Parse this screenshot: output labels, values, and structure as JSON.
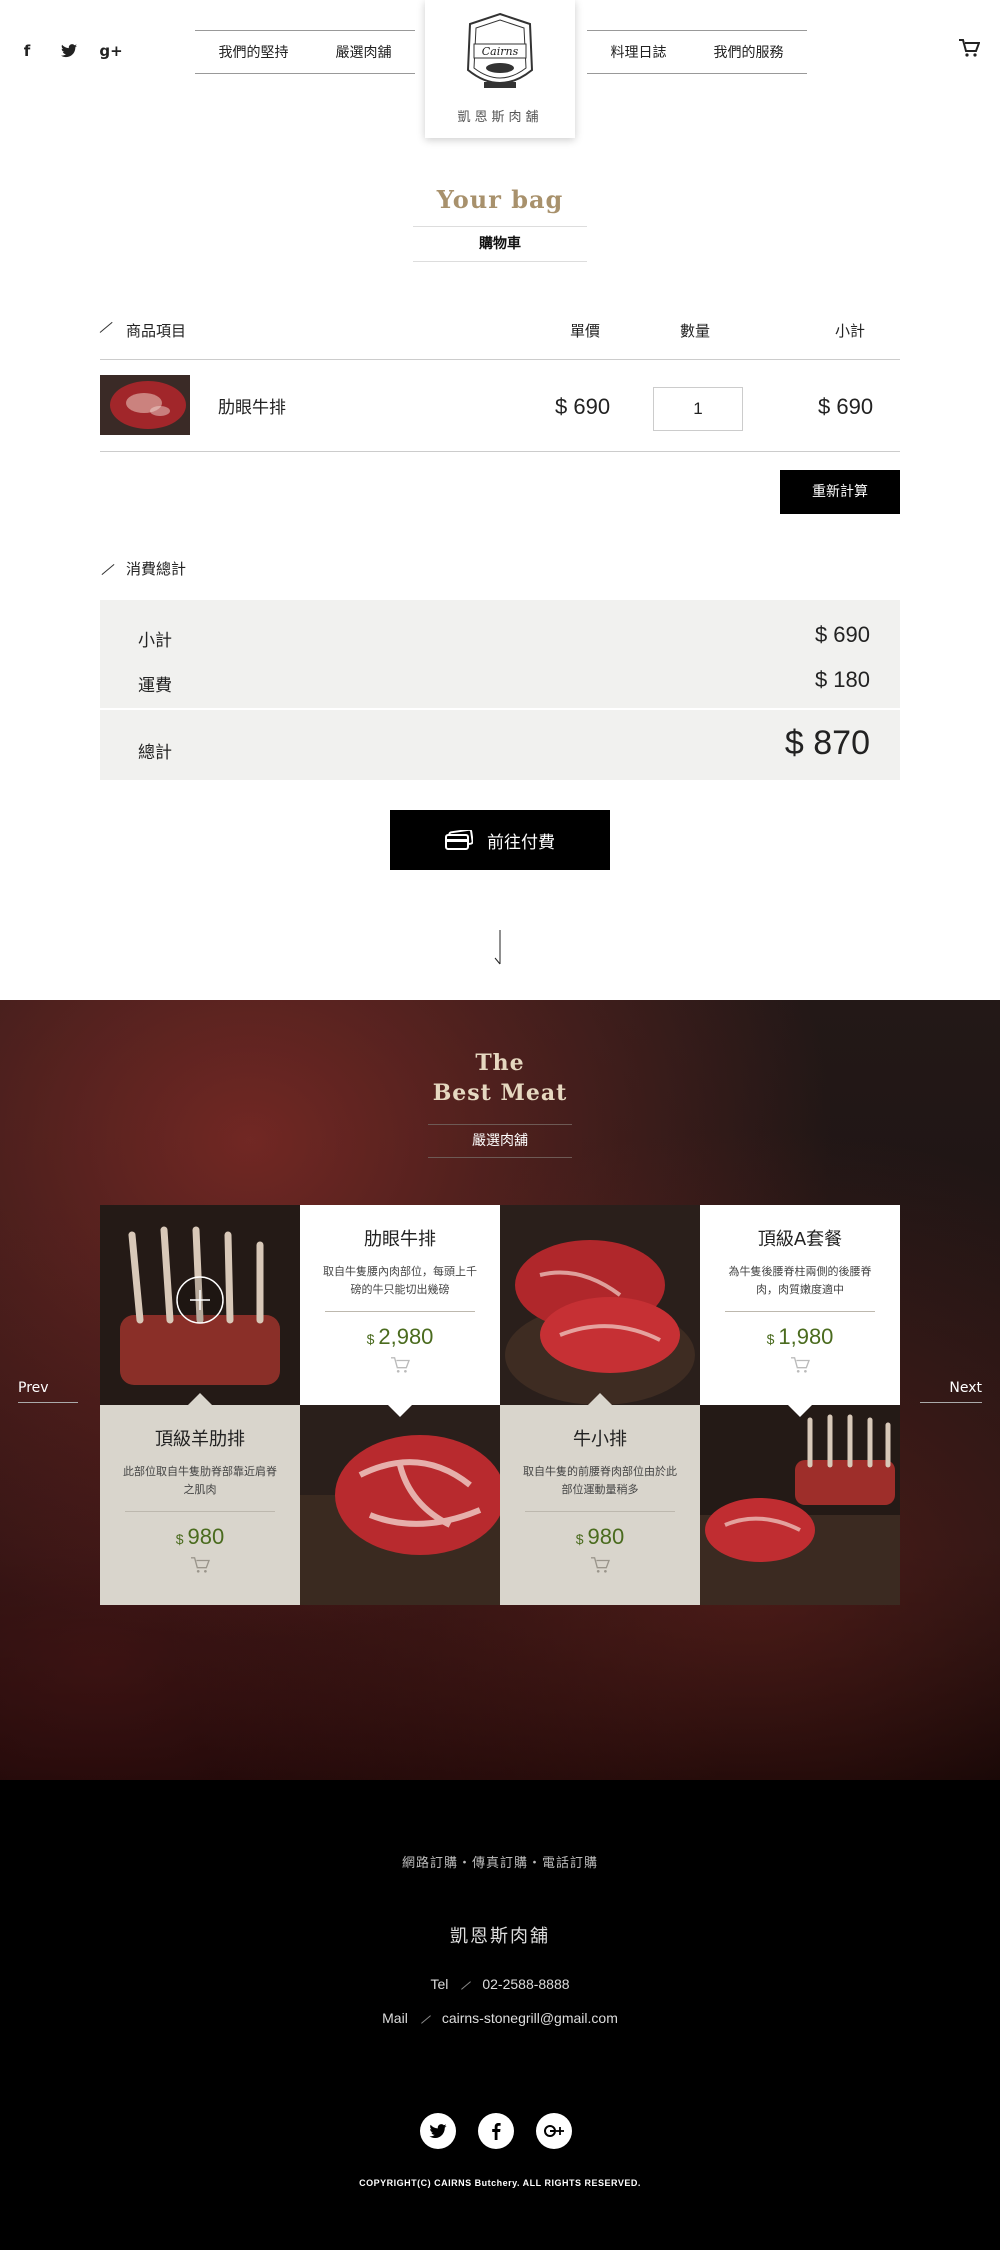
{
  "header": {
    "social": [
      "facebook-icon",
      "twitter-icon",
      "google-plus-icon"
    ],
    "social_glyphs": [
      "f",
      "t",
      "g+"
    ],
    "nav_left": [
      "我們的堅持",
      "嚴選肉舖"
    ],
    "nav_right": [
      "料理日誌",
      "我們的服務"
    ],
    "logo_text": "凱恩斯肉舖"
  },
  "cart": {
    "title_en": "Your bag",
    "title_zh": "購物車",
    "columns": {
      "item": "商品項目",
      "price": "單價",
      "qty": "數量",
      "subtotal": "小計"
    },
    "rows": [
      {
        "name": "肋眼牛排",
        "price": "$ 690",
        "qty": "1",
        "subtotal": "$ 690"
      }
    ],
    "recalc_label": "重新計算"
  },
  "totals": {
    "section_label": "消費總計",
    "subtotal_label": "小計",
    "subtotal_value": "$ 690",
    "shipping_label": "運費",
    "shipping_value": "$ 180",
    "total_label": "總計",
    "total_value": "$ 870"
  },
  "checkout_label": "前往付費",
  "meat": {
    "title_line1": "The",
    "title_line2": "Best Meat",
    "subtitle": "嚴選肉舖",
    "prev": "Prev",
    "next": "Next",
    "products": [
      {
        "name": "肋眼牛排",
        "desc": "取自牛隻腰內肉部位，每頭上千磅的牛只能切出幾磅",
        "currency": "$",
        "price": "2,980"
      },
      {
        "name": "頂級A套餐",
        "desc": "為牛隻後腰脊柱兩側的後腰脊肉，肉質嫩度適中",
        "currency": "$",
        "price": "1,980"
      },
      {
        "name": "頂級羊肋排",
        "desc": "此部位取自牛隻肋脊部靠近肩脊之肌肉",
        "currency": "$",
        "price": "980"
      },
      {
        "name": "牛小排",
        "desc": "取自牛隻的前腰脊肉部位由於此部位運動量稍多",
        "currency": "$",
        "price": "980"
      }
    ]
  },
  "footer": {
    "order_types": "網路訂購・傳真訂購・電話訂購",
    "shop_name": "凱恩斯肉舖",
    "tel_label": "Tel",
    "tel": "02-2588-8888",
    "mail_label": "Mail",
    "mail": "cairns-stonegrill@gmail.com",
    "social": [
      "twitter-icon",
      "facebook-icon",
      "google-plus-icon"
    ],
    "copyright": "COPYRIGHT(C) CAIRNS Butchery. ALL RIGHTS RESERVED."
  },
  "colors": {
    "accent_gold": "#a8916c",
    "price_green": "#4a6b1e",
    "beige": "#d9d5cc",
    "black": "#000000"
  }
}
